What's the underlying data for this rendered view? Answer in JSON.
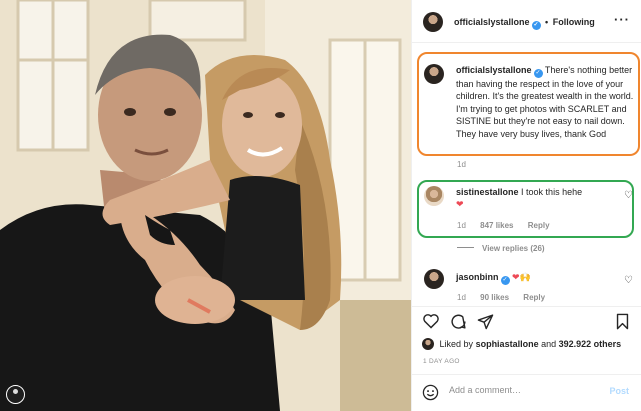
{
  "post": {
    "author": "officialslystallone",
    "follow_label": "Following",
    "separator": "•",
    "more_label": "···"
  },
  "caption": {
    "author": "officialslystallone",
    "text": "There's nothing better than having the respect in the love of your children. It's the greatest wealth in the world. I'm trying to get photos with SCARLET and SISTINE but they're not easy to nail down. They have very busy lives, thank God",
    "time": "1d"
  },
  "comments": [
    {
      "author": "sistinestallone",
      "text": "I took this hehe",
      "emoji": "❤",
      "time": "1d",
      "likes": "847 likes",
      "reply_label": "Reply"
    },
    {
      "author": "jasonbinn",
      "emoji_1": "❤",
      "emoji_2": "🙌",
      "time": "1d",
      "likes": "90 likes",
      "reply_label": "Reply"
    }
  ],
  "view_replies": "View replies (26)",
  "likes_summary": {
    "prefix": "Liked by",
    "user": "sophiastallone",
    "middle": "and",
    "count": "392.922 others"
  },
  "post_time": "1 DAY AGO",
  "add_comment": {
    "placeholder": "Add a comment…",
    "post_label": "Post"
  },
  "colors": {
    "caption_highlight": "#f0862e",
    "comment_highlight": "#33a852",
    "verified": "#3897f0",
    "heart": "#ed4956"
  }
}
